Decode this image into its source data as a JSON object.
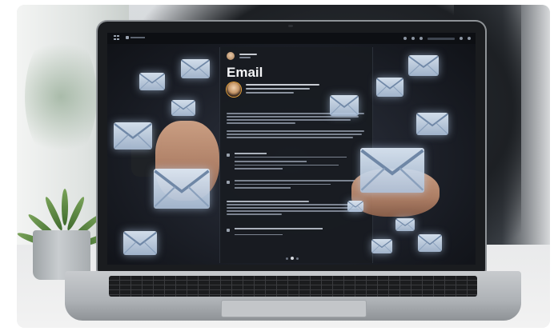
{
  "screen": {
    "title": "Email",
    "topbar": {
      "menu_icon": "grid-icon",
      "app_icon": "mail-app-icon",
      "right_icons": [
        "settings-icon",
        "refresh-icon",
        "search-icon",
        "close-icon"
      ]
    },
    "envelope_icon": "envelope-icon"
  },
  "colors": {
    "screen_bg": "#171a21",
    "panel_bg": "#181b21",
    "envelope": "#dbe6f3",
    "glow": "#bed7f5"
  }
}
